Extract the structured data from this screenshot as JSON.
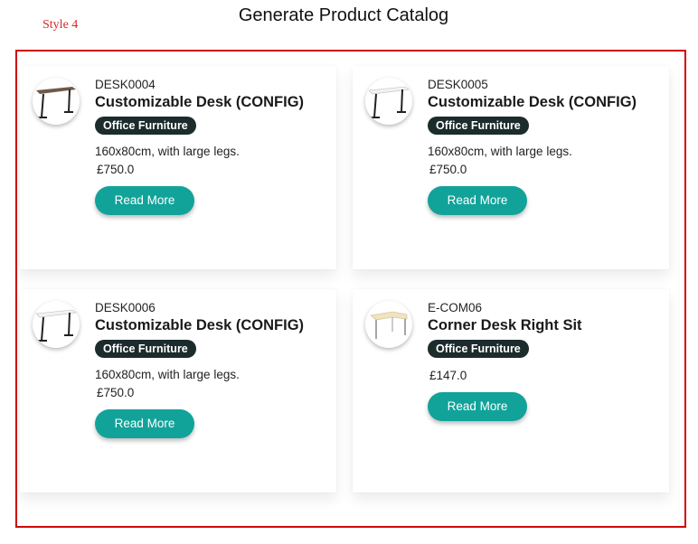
{
  "style_label": "Style 4",
  "page_title": "Generate Product Catalog",
  "products": [
    {
      "sku": "DESK0004",
      "name": "Customizable Desk (CONFIG)",
      "category": "Office Furniture",
      "description": "160x80cm, with large legs.",
      "price": "£750.0",
      "button": "Read More",
      "icon": "desk-icon"
    },
    {
      "sku": "DESK0005",
      "name": "Customizable Desk (CONFIG)",
      "category": "Office Furniture",
      "description": "160x80cm, with large legs.",
      "price": "£750.0",
      "button": "Read More",
      "icon": "desk-icon"
    },
    {
      "sku": "DESK0006",
      "name": "Customizable Desk (CONFIG)",
      "category": "Office Furniture",
      "description": "160x80cm, with large legs.",
      "price": "£750.0",
      "button": "Read More",
      "icon": "desk-icon"
    },
    {
      "sku": "E-COM06",
      "name": "Corner Desk Right Sit",
      "category": "Office Furniture",
      "description": "",
      "price": "£147.0",
      "button": "Read More",
      "icon": "corner-desk-icon"
    }
  ],
  "colors": {
    "accent": "#11a39a",
    "badge": "#1c2b2b",
    "frame": "#d00000",
    "style_label": "#d62828"
  }
}
